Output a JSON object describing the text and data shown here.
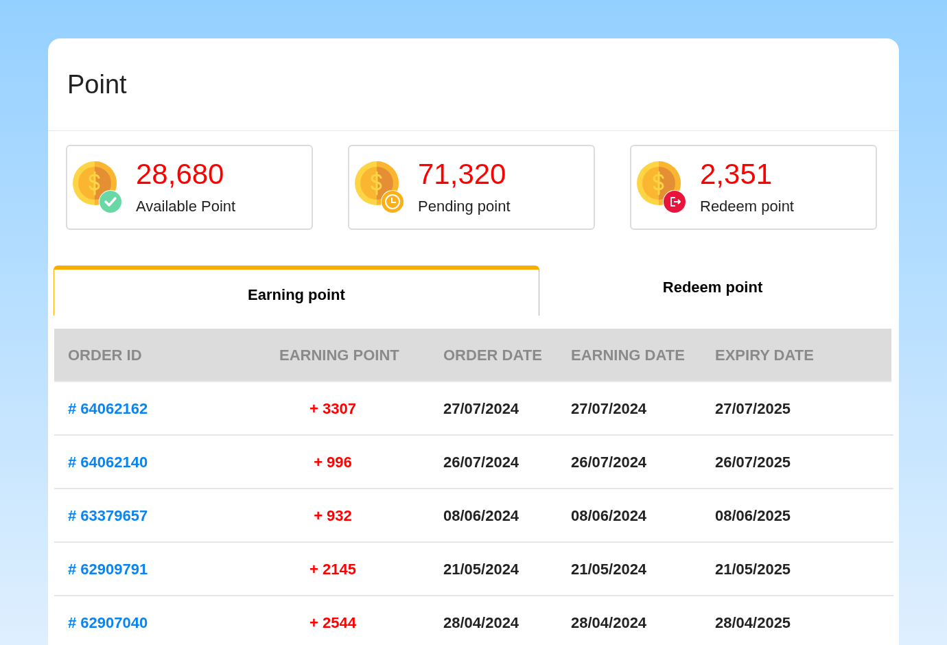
{
  "title": "Point",
  "stats": [
    {
      "value": "28,680",
      "label": "Available Point",
      "kind": "available"
    },
    {
      "value": "71,320",
      "label": "Pending point",
      "kind": "pending"
    },
    {
      "value": "2,351",
      "label": "Redeem point",
      "kind": "redeem"
    }
  ],
  "tabs": [
    {
      "label": "Earning point",
      "selected": true
    },
    {
      "label": "Redeem point",
      "selected": false
    }
  ],
  "table": {
    "columns": [
      "ORDER ID",
      "EARNING POINT",
      "ORDER DATE",
      "EARNING DATE",
      "EXPIRY DATE"
    ],
    "rows": [
      [
        "# 64062162",
        "+ 3307",
        "27/07/2024",
        "27/07/2024",
        "27/07/2025"
      ],
      [
        "# 64062140",
        "+ 996",
        "26/07/2024",
        "26/07/2024",
        "26/07/2025"
      ],
      [
        "# 63379657",
        "+ 932",
        "08/06/2024",
        "08/06/2024",
        "08/06/2025"
      ],
      [
        "# 62909791",
        "+ 2145",
        "21/05/2024",
        "21/05/2024",
        "21/05/2025"
      ],
      [
        "# 62907040",
        "+ 2544",
        "28/04/2024",
        "28/04/2024",
        "28/04/2025"
      ]
    ]
  }
}
